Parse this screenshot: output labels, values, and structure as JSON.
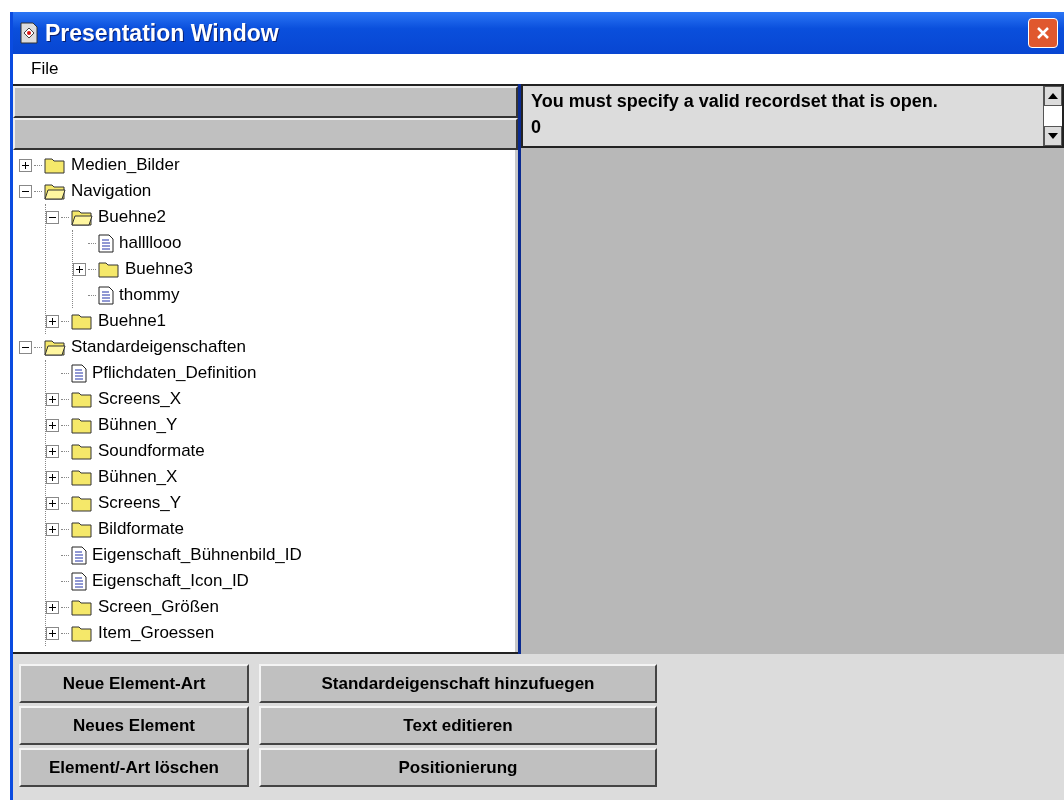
{
  "window": {
    "title": "Presentation Window"
  },
  "menu": [
    "File"
  ],
  "tree": [
    {
      "label": "Medien_Bilder",
      "kind": "folder",
      "expanded": false
    },
    {
      "label": "Navigation",
      "kind": "folder",
      "expanded": true,
      "children": [
        {
          "label": "Buehne2",
          "kind": "folder",
          "expanded": true,
          "children": [
            {
              "label": "hallllooo",
              "kind": "document"
            },
            {
              "label": "Buehne3",
              "kind": "folder",
              "expanded": false
            },
            {
              "label": "thommy",
              "kind": "document"
            }
          ]
        },
        {
          "label": "Buehne1",
          "kind": "folder",
          "expanded": false
        }
      ]
    },
    {
      "label": "Standardeigenschaften",
      "kind": "folder",
      "expanded": true,
      "children": [
        {
          "label": "Pflichdaten_Definition",
          "kind": "document"
        },
        {
          "label": "Screens_X",
          "kind": "folder",
          "expanded": false
        },
        {
          "label": "Bühnen_Y",
          "kind": "folder",
          "expanded": false
        },
        {
          "label": "Soundformate",
          "kind": "folder",
          "expanded": false
        },
        {
          "label": "Bühnen_X",
          "kind": "folder",
          "expanded": false
        },
        {
          "label": "Screens_Y",
          "kind": "folder",
          "expanded": false
        },
        {
          "label": "Bildformate",
          "kind": "folder",
          "expanded": false
        },
        {
          "label": "Eigenschaft_Bühnenbild_ID",
          "kind": "document"
        },
        {
          "label": "Eigenschaft_Icon_ID",
          "kind": "document"
        },
        {
          "label": "Screen_Größen",
          "kind": "folder",
          "expanded": false
        },
        {
          "label": "Item_Groessen",
          "kind": "folder",
          "expanded": false
        }
      ]
    }
  ],
  "message": {
    "lines": [
      "You must specify a valid recordset that is open.",
      "0"
    ]
  },
  "buttons": [
    [
      "Neue Element-Art",
      "Neues Element",
      "Element/-Art löschen"
    ],
    [
      "Standardeigenschaft hinzufuegen",
      "Text editieren",
      "Positionierung"
    ]
  ]
}
